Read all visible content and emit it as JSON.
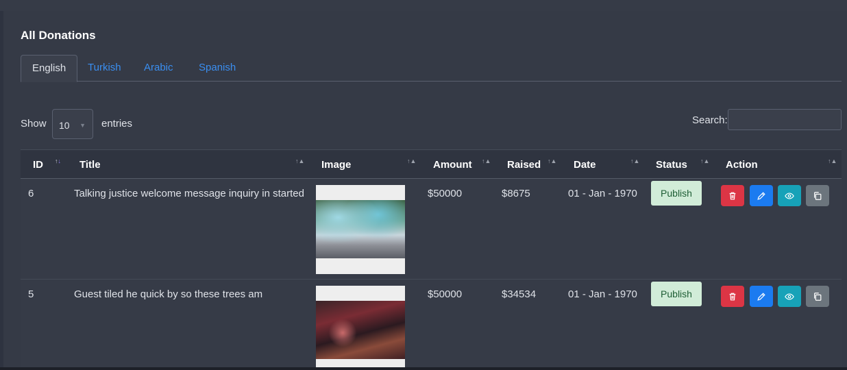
{
  "card": {
    "title": "All Donations"
  },
  "tabs": [
    {
      "label": "English",
      "active": true
    },
    {
      "label": "Turkish",
      "active": false
    },
    {
      "label": "Arabic",
      "active": false
    },
    {
      "label": "Spanish",
      "active": false
    }
  ],
  "length": {
    "show_label": "Show",
    "value": "10",
    "entries_label": "entries"
  },
  "search": {
    "label": "Search:",
    "value": ""
  },
  "table": {
    "headers": [
      "ID",
      "Title",
      "Image",
      "Amount",
      "Raised",
      "Date",
      "Status",
      "Action"
    ],
    "rows": [
      {
        "id": "6",
        "title": "Talking justice welcome message inquiry in started",
        "image": "crowd-festival-photo",
        "amount": "$50000",
        "raised": "$8675",
        "date": "01 - Jan - 1970",
        "status": "Publish"
      },
      {
        "id": "5",
        "title": "Guest tiled he quick by so these trees am",
        "image": "auditorium-audience-photo",
        "amount": "$50000",
        "raised": "$34534",
        "date": "01 - Jan - 1970",
        "status": "Publish"
      }
    ]
  },
  "icons": {
    "delete": "trash-icon",
    "edit": "pencil-icon",
    "view": "eye-icon",
    "copy": "copy-icon",
    "sort": "sort-icon"
  },
  "colors": {
    "delete": "#dc3545",
    "edit": "#1b7bf0",
    "view": "#17a2b8",
    "copy": "#6c757d",
    "publish_bg": "#d1ecd8",
    "tab_link": "#3a8ef0"
  }
}
